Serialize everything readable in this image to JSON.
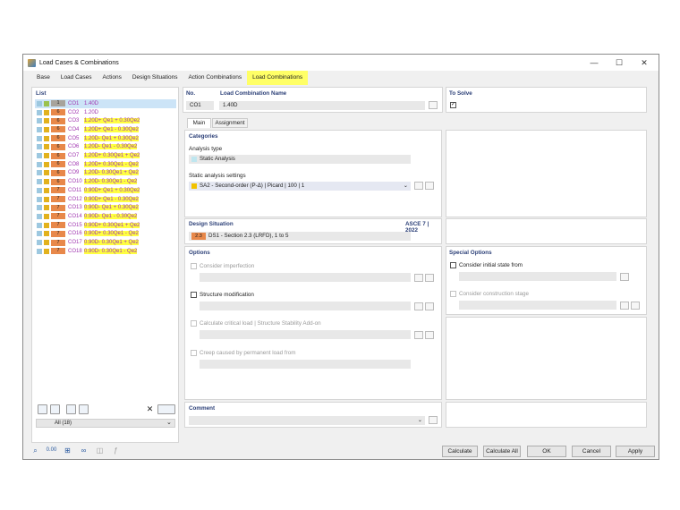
{
  "window": {
    "title": "Load Cases & Combinations",
    "controls": [
      "—",
      "☐",
      "✕"
    ]
  },
  "tabs": [
    "Base",
    "Load Cases",
    "Actions",
    "Design Situations",
    "Action Combinations",
    "Load Combinations"
  ],
  "list": {
    "header": "List",
    "rows": [
      {
        "badge": "1",
        "code": "CO1",
        "formula": "1.40D",
        "hl": false
      },
      {
        "badge": "6",
        "code": "CO2",
        "formula": "1.20D",
        "hl": false
      },
      {
        "badge": "6",
        "code": "CO3",
        "formula": "1.20D",
        "tail": "+ Qe1 + 0.30Qe2",
        "hl": true
      },
      {
        "badge": "6",
        "code": "CO4",
        "formula": "1.20D",
        "tail": "+ Qe1 - 0.30Qe2",
        "hl": true
      },
      {
        "badge": "6",
        "code": "CO5",
        "formula": "1.20D",
        "tail": "- Qe1 + 0.30Qe2",
        "hl": true
      },
      {
        "badge": "6",
        "code": "CO6",
        "formula": "1.20D",
        "tail": "- Qe1 - 0.30Qe2",
        "hl": true
      },
      {
        "badge": "6",
        "code": "CO7",
        "formula": "1.20D",
        "tail": "+ 0.30Qe1 + Qe2",
        "hl": true
      },
      {
        "badge": "6",
        "code": "CO8",
        "formula": "1.20D",
        "tail": "+ 0.30Qe1 - Qe2",
        "hl": true
      },
      {
        "badge": "6",
        "code": "CO9",
        "formula": "1.20D",
        "tail": "- 0.30Qe1 + Qe2",
        "hl": true
      },
      {
        "badge": "6",
        "code": "CO10",
        "formula": "1.20D",
        "tail": "- 0.30Qe1 - Qe2",
        "hl": true
      },
      {
        "badge": "7",
        "code": "CO11",
        "formula": "0.90D",
        "tail": "+ Qe1 + 0.30Qe2",
        "hl": true
      },
      {
        "badge": "7",
        "code": "CO12",
        "formula": "0.90D",
        "tail": "+ Qe1 - 0.30Qe2",
        "hl": true
      },
      {
        "badge": "7",
        "code": "CO13",
        "formula": "0.90D",
        "tail": "- Qe1 + 0.30Qe2",
        "hl": true
      },
      {
        "badge": "7",
        "code": "CO14",
        "formula": "0.90D",
        "tail": "- Qe1 - 0.30Qe2",
        "hl": true
      },
      {
        "badge": "7",
        "code": "CO15",
        "formula": "0.90D",
        "tail": "+ 0.30Qe1 + Qe2",
        "hl": true
      },
      {
        "badge": "7",
        "code": "CO16",
        "formula": "0.90D",
        "tail": "+ 0.30Qe1 - Qe2",
        "hl": true
      },
      {
        "badge": "7",
        "code": "CO17",
        "formula": "0.90D",
        "tail": "- 0.30Qe1 + Qe2",
        "hl": true
      },
      {
        "badge": "7",
        "code": "CO18",
        "formula": "0.90D",
        "tail": "- 0.30Qe1 - Qe2",
        "hl": true
      }
    ],
    "filter": "All (18)"
  },
  "header": {
    "no_label": "No.",
    "no_value": "CO1",
    "name_label": "Load Combination Name",
    "name_value": "1.40D",
    "solve_label": "To Solve",
    "solve_checked": "✓"
  },
  "subtabs": [
    "Main",
    "Assignment"
  ],
  "categories": {
    "title": "Categories",
    "analysis_type_label": "Analysis type",
    "analysis_type": "Static Analysis",
    "settings_label": "Static analysis settings",
    "settings_value": "SA2 - Second-order (P-Δ) | Picard | 100 | 1"
  },
  "design": {
    "title": "Design Situation",
    "standard": "ASCE 7 | 2022",
    "badge": "2.3",
    "value": "DS1 - Section 2.3 (LRFD), 1 to 5"
  },
  "options": {
    "title": "Options",
    "imperfection": "Consider imperfection",
    "structure_mod": "Structure modification",
    "critical_load": "Calculate critical load | Structure Stability Add-on",
    "creep": "Creep caused by permanent load from"
  },
  "special": {
    "title": "Special Options",
    "initial_state": "Consider initial state from",
    "construction": "Consider construction stage"
  },
  "comment": {
    "title": "Comment"
  },
  "footer": {
    "calculate": "Calculate",
    "calculate_all": "Calculate All",
    "ok": "OK",
    "cancel": "Cancel",
    "apply": "Apply"
  }
}
